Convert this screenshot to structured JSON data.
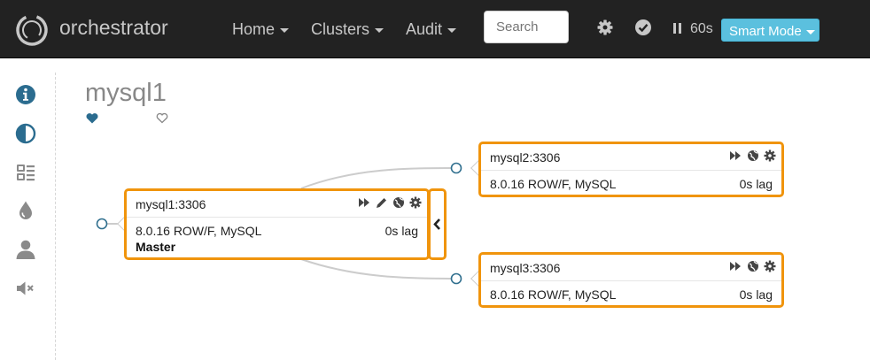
{
  "navbar": {
    "brand": "orchestrator",
    "menus": [
      {
        "label": "Home"
      },
      {
        "label": "Clusters"
      },
      {
        "label": "Audit"
      }
    ],
    "search_placeholder": "Search",
    "refresh_interval": "60s",
    "mode_label": "Smart Mode"
  },
  "sidebar": {
    "icons": [
      "info-icon",
      "contrast-icon",
      "list-icon",
      "drop-icon",
      "user-icon",
      "mute-icon"
    ]
  },
  "page": {
    "title": "mysql1"
  },
  "colors": {
    "navbar": "#222222",
    "node_border": "#f0940c",
    "mode_button": "#5bc0de",
    "sidebar_icon_primary": "#2b6c8f",
    "sidebar_icon_secondary": "#8a8a8a"
  },
  "nodes": [
    {
      "name": "mysql1:3306",
      "version": "8.0.16 ROW/F, MySQL",
      "lag": "0s lag",
      "role": "Master"
    },
    {
      "name": "mysql2:3306",
      "version": "8.0.16 ROW/F, MySQL",
      "lag": "0s lag"
    },
    {
      "name": "mysql3:3306",
      "version": "8.0.16 ROW/F, MySQL",
      "lag": "0s lag"
    }
  ]
}
